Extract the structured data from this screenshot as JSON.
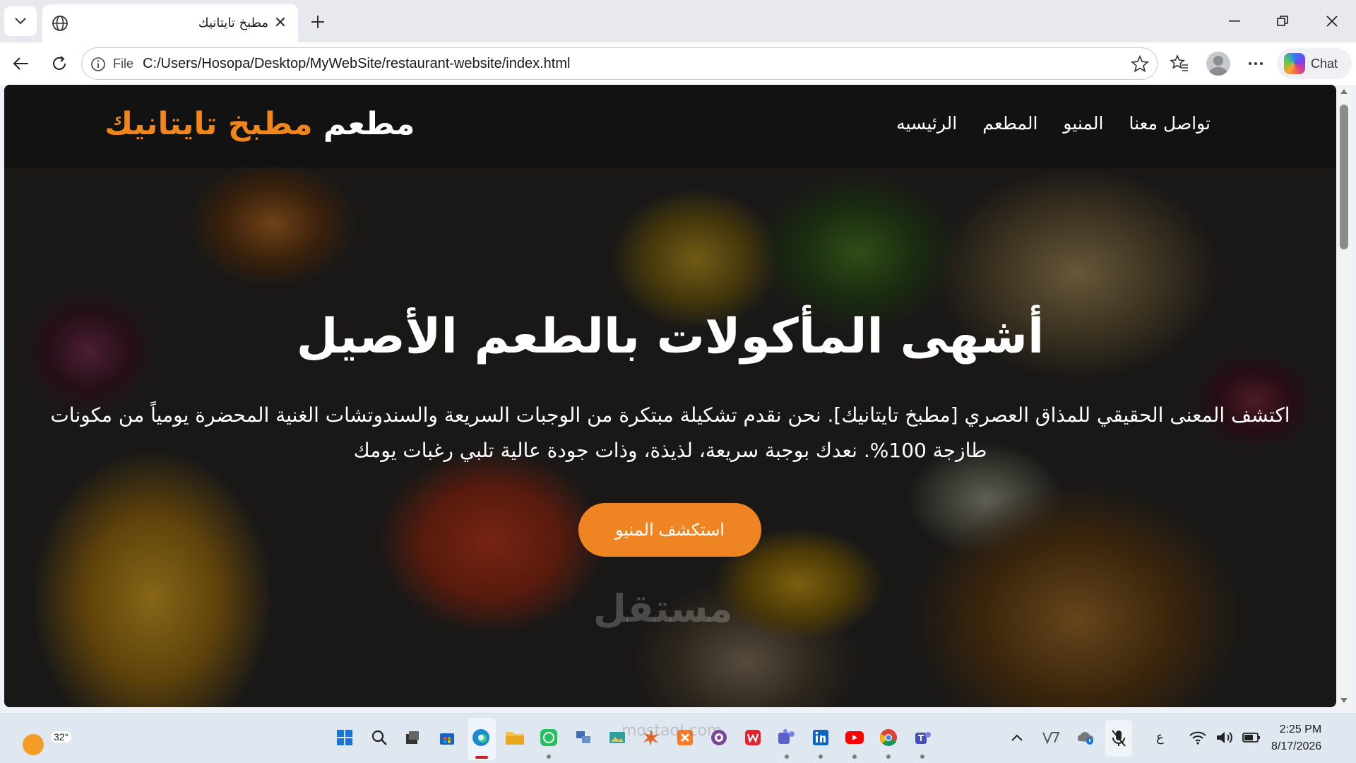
{
  "browser": {
    "tab": {
      "title": "مطبخ تايتانيك",
      "close_glyph": "✕"
    },
    "new_tab_glyph": "+",
    "window_controls": {
      "minimize": "—",
      "restore": "❐",
      "close": "✕"
    },
    "address": {
      "scheme_label": "File",
      "url": "C:/Users/Hosopa/Desktop/MyWebSite/restaurant-website/index.html"
    },
    "copilot": {
      "label": "Chat"
    }
  },
  "site": {
    "logo": {
      "part1": "مطعم",
      "part2": "مطبخ تايتانيك"
    },
    "nav": [
      "الرئيسيه",
      "المطعم",
      "المنيو",
      "تواصل معنا"
    ],
    "hero": {
      "title": "أشهى المأكولات بالطعم الأصيل",
      "description": "اكتشف المعنى الحقيقي للمذاق العصري [مطبخ تايتانيك]. نحن نقدم تشكيلة مبتكرة من الوجبات السريعة والسندوتشات الغنية المحضرة يومياً من مكونات طازجة 100%. نعدك بوجبة سريعة، لذيذة، وذات جودة عالية تلبي رغبات يومك",
      "cta": "استكشف المنيو"
    },
    "watermark": "مستقل",
    "watermark_sub": "mostaql.com"
  },
  "taskbar": {
    "weather_temp": "32°",
    "ime": "ع",
    "time": "2:25 PM",
    "date": "8/17/2026",
    "apps": [
      "windows-start",
      "search",
      "task-view",
      "microsoft-store",
      "edge",
      "file-explorer",
      "whatsapp",
      "network-app",
      "gallery-app",
      "burst-app",
      "xampp",
      "tor-browser",
      "wps-office",
      "teams",
      "linkedin",
      "youtube",
      "chrome",
      "teams-classic"
    ]
  },
  "colors": {
    "accent_orange": "#f0851a",
    "header_bg": "#121212",
    "cta_bg": "#ee8522"
  }
}
